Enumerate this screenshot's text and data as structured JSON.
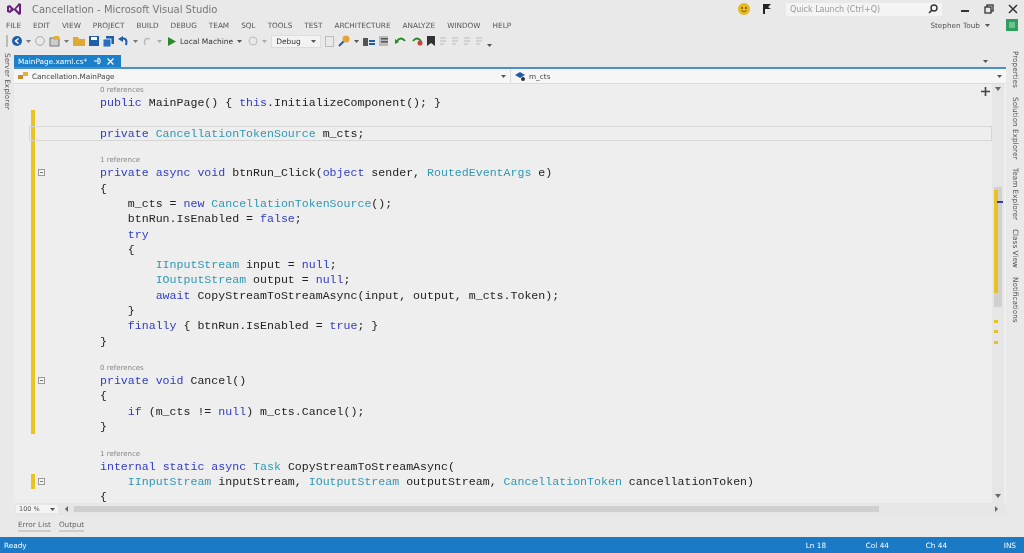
{
  "window": {
    "title": "Cancellation - Microsoft Visual Studio"
  },
  "quick_launch": {
    "placeholder": "Quick Launch (Ctrl+Q)"
  },
  "menu": [
    "FILE",
    "EDIT",
    "VIEW",
    "PROJECT",
    "BUILD",
    "DEBUG",
    "TEAM",
    "SQL",
    "TOOLS",
    "TEST",
    "ARCHITECTURE",
    "ANALYZE",
    "WINDOW",
    "HELP"
  ],
  "account": {
    "user": "Stephen Toub"
  },
  "toolbar": {
    "run_target": "Local Machine",
    "configuration": "Debug"
  },
  "left_tool_tabs": [
    "Server Explorer"
  ],
  "right_tool_tabs": [
    "Properties",
    "Solution Explorer",
    "Team Explorer",
    "Class View",
    "Notifications"
  ],
  "document_tabs": [
    {
      "label": "MainPage.xaml.cs*",
      "selected": true
    }
  ],
  "navigation": {
    "type": "Cancellation.MainPage",
    "member": "m_cts"
  },
  "editor": {
    "lines": [
      {
        "kind": "lens",
        "text": "0 references",
        "changed": false
      },
      {
        "kind": "code",
        "changed": false,
        "current": false,
        "fold": false,
        "tokens": [
          {
            "kind": "keyword",
            "text": "public"
          },
          {
            "kind": "plain",
            "text": " MainPage() { "
          },
          {
            "kind": "keyword",
            "text": "this"
          },
          {
            "kind": "plain",
            "text": ".InitializeComponent(); }"
          }
        ]
      },
      {
        "kind": "blank",
        "changed": true
      },
      {
        "kind": "code",
        "changed": true,
        "current": true,
        "fold": false,
        "tokens": [
          {
            "kind": "keyword",
            "text": "private"
          },
          {
            "kind": "type",
            "text": " CancellationTokenSource"
          },
          {
            "kind": "plain",
            "text": " m_cts;"
          }
        ]
      },
      {
        "kind": "blank",
        "changed": true
      },
      {
        "kind": "lens",
        "text": "1 reference",
        "changed": true
      },
      {
        "kind": "code",
        "changed": true,
        "current": false,
        "fold": true,
        "tokens": [
          {
            "kind": "keyword",
            "text": "private"
          },
          {
            "kind": "keyword",
            "text": " async"
          },
          {
            "kind": "keyword",
            "text": " void"
          },
          {
            "kind": "plain",
            "text": " btnRun_Click("
          },
          {
            "kind": "keyword",
            "text": "object"
          },
          {
            "kind": "plain",
            "text": " sender, "
          },
          {
            "kind": "type",
            "text": "RoutedEventArgs"
          },
          {
            "kind": "plain",
            "text": " e)"
          }
        ]
      },
      {
        "kind": "code",
        "changed": true,
        "current": false,
        "fold": false,
        "tokens": [
          {
            "kind": "plain",
            "text": "{"
          }
        ]
      },
      {
        "kind": "code",
        "changed": true,
        "current": false,
        "fold": false,
        "tokens": [
          {
            "kind": "plain",
            "text": "    m_cts = "
          },
          {
            "kind": "keyword",
            "text": "new"
          },
          {
            "kind": "type",
            "text": " CancellationTokenSource"
          },
          {
            "kind": "plain",
            "text": "();"
          }
        ]
      },
      {
        "kind": "code",
        "changed": true,
        "current": false,
        "fold": false,
        "tokens": [
          {
            "kind": "plain",
            "text": "    btnRun.IsEnabled = "
          },
          {
            "kind": "keyword",
            "text": "false"
          },
          {
            "kind": "plain",
            "text": ";"
          }
        ]
      },
      {
        "kind": "code",
        "changed": true,
        "current": false,
        "fold": false,
        "tokens": [
          {
            "kind": "keyword",
            "text": "    try"
          }
        ]
      },
      {
        "kind": "code",
        "changed": true,
        "current": false,
        "fold": false,
        "tokens": [
          {
            "kind": "plain",
            "text": "    {"
          }
        ]
      },
      {
        "kind": "code",
        "changed": true,
        "current": false,
        "fold": false,
        "tokens": [
          {
            "kind": "type",
            "text": "        IInputStream"
          },
          {
            "kind": "plain",
            "text": " input = "
          },
          {
            "kind": "keyword",
            "text": "null"
          },
          {
            "kind": "plain",
            "text": ";"
          }
        ]
      },
      {
        "kind": "code",
        "changed": true,
        "current": false,
        "fold": false,
        "tokens": [
          {
            "kind": "type",
            "text": "        IOutputStream"
          },
          {
            "kind": "plain",
            "text": " output = "
          },
          {
            "kind": "keyword",
            "text": "null"
          },
          {
            "kind": "plain",
            "text": ";"
          }
        ]
      },
      {
        "kind": "code",
        "changed": true,
        "current": false,
        "fold": false,
        "tokens": [
          {
            "kind": "keyword",
            "text": "        await"
          },
          {
            "kind": "plain",
            "text": " CopyStreamToStreamAsync(input, output, m_cts.Token);"
          }
        ]
      },
      {
        "kind": "code",
        "changed": true,
        "current": false,
        "fold": false,
        "tokens": [
          {
            "kind": "plain",
            "text": "    }"
          }
        ]
      },
      {
        "kind": "code",
        "changed": true,
        "current": false,
        "fold": false,
        "tokens": [
          {
            "kind": "keyword",
            "text": "    finally"
          },
          {
            "kind": "plain",
            "text": " { btnRun.IsEnabled = "
          },
          {
            "kind": "keyword",
            "text": "true"
          },
          {
            "kind": "plain",
            "text": "; }"
          }
        ]
      },
      {
        "kind": "code",
        "changed": true,
        "current": false,
        "fold": false,
        "tokens": [
          {
            "kind": "plain",
            "text": "}"
          }
        ]
      },
      {
        "kind": "blank",
        "changed": true
      },
      {
        "kind": "lens",
        "text": "0 references",
        "changed": true
      },
      {
        "kind": "code",
        "changed": true,
        "current": false,
        "fold": true,
        "tokens": [
          {
            "kind": "keyword",
            "text": "private"
          },
          {
            "kind": "keyword",
            "text": " void"
          },
          {
            "kind": "plain",
            "text": " Cancel()"
          }
        ]
      },
      {
        "kind": "code",
        "changed": true,
        "current": false,
        "fold": false,
        "tokens": [
          {
            "kind": "plain",
            "text": "{"
          }
        ]
      },
      {
        "kind": "code",
        "changed": true,
        "current": false,
        "fold": false,
        "tokens": [
          {
            "kind": "keyword",
            "text": "    if"
          },
          {
            "kind": "plain",
            "text": " (m_cts != "
          },
          {
            "kind": "keyword",
            "text": "null"
          },
          {
            "kind": "plain",
            "text": ") m_cts.Cancel();"
          }
        ]
      },
      {
        "kind": "code",
        "changed": true,
        "current": false,
        "fold": false,
        "tokens": [
          {
            "kind": "plain",
            "text": "}"
          }
        ]
      },
      {
        "kind": "blank",
        "changed": false
      },
      {
        "kind": "lens",
        "text": "1 reference",
        "changed": false
      },
      {
        "kind": "code",
        "changed": false,
        "current": false,
        "fold": false,
        "tokens": [
          {
            "kind": "keyword",
            "text": "internal"
          },
          {
            "kind": "keyword",
            "text": " static"
          },
          {
            "kind": "keyword",
            "text": " async"
          },
          {
            "kind": "type",
            "text": " Task"
          },
          {
            "kind": "plain",
            "text": " CopyStreamToStreamAsync("
          }
        ]
      },
      {
        "kind": "code",
        "changed": true,
        "current": false,
        "fold": true,
        "tokens": [
          {
            "kind": "type",
            "text": "    IInputStream"
          },
          {
            "kind": "plain",
            "text": " inputStream, "
          },
          {
            "kind": "type",
            "text": "IOutputStream"
          },
          {
            "kind": "plain",
            "text": " outputStream, "
          },
          {
            "kind": "type",
            "text": "CancellationToken"
          },
          {
            "kind": "plain",
            "text": " cancellationToken)"
          }
        ]
      },
      {
        "kind": "code",
        "changed": false,
        "current": false,
        "fold": false,
        "tokens": [
          {
            "kind": "plain",
            "text": "{"
          }
        ]
      }
    ]
  },
  "zoom": "100 %",
  "bottom_tabs": [
    {
      "label": "Error List",
      "selected": false
    },
    {
      "label": "Output",
      "selected": false
    }
  ],
  "status_bar": {
    "message": "Ready",
    "line": "Ln 18",
    "column": "Col 44",
    "char": "Ch 44",
    "mode": "INS"
  }
}
